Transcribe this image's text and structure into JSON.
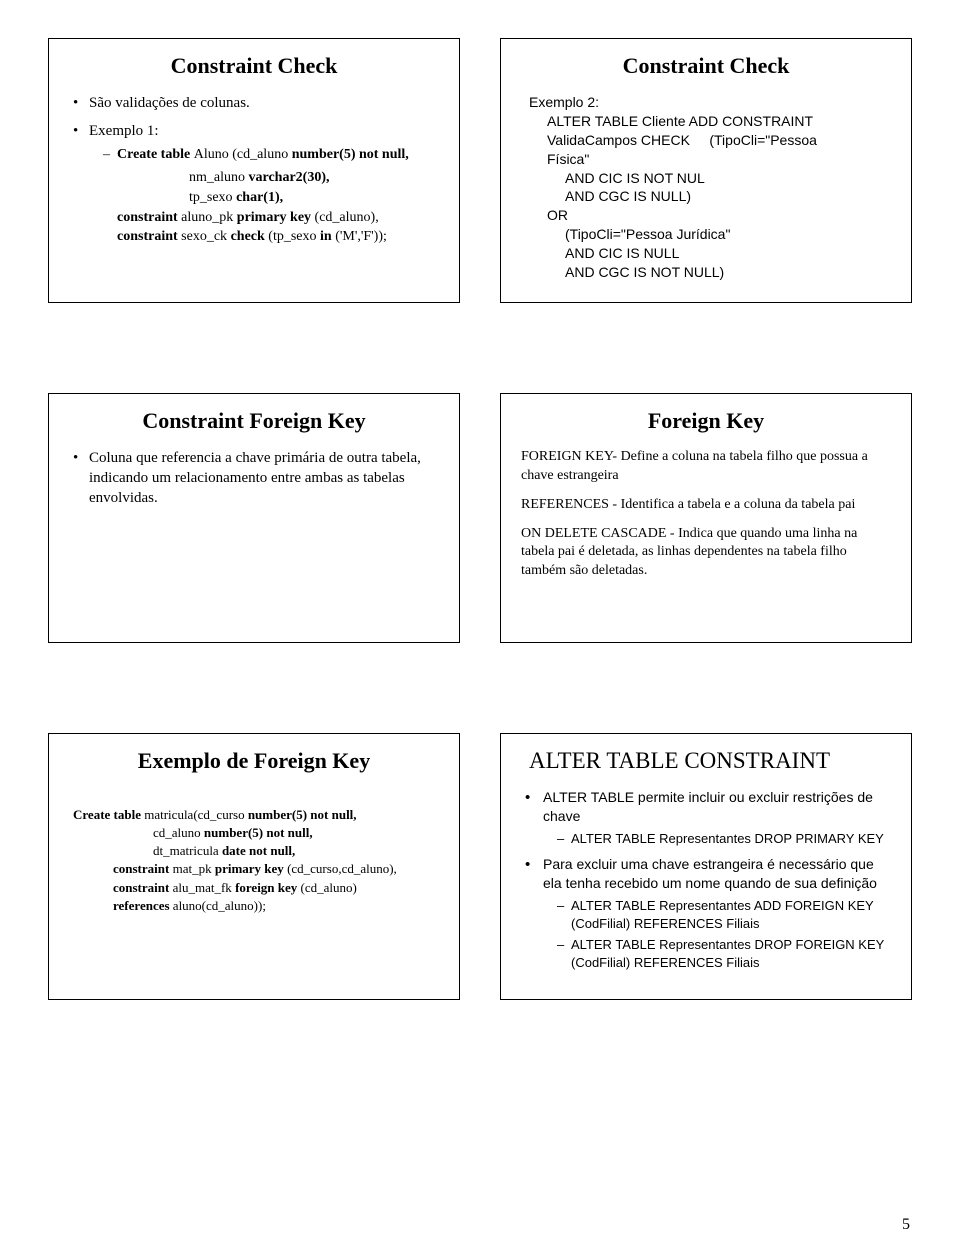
{
  "page_number": "5",
  "slides": {
    "s1": {
      "title": "Constraint Check",
      "bullet1": "São validações de colunas.",
      "bullet2": "Exemplo 1:",
      "code": {
        "l1a": "Create table ",
        "l1b": "Aluno (cd_aluno ",
        "l1c": "number(5) not null,",
        "l2a": "nm_aluno ",
        "l2b": "varchar2(30),",
        "l3a": "tp_sexo ",
        "l3b": "char(1),",
        "l4a": "constraint ",
        "l4b": "aluno_pk ",
        "l4c": "primary key ",
        "l4d": "(cd_aluno),",
        "l5a": "constraint ",
        "l5b": "sexo_ck ",
        "l5c": "check ",
        "l5d": "(tp_sexo ",
        "l5e": "in ",
        "l5f": "('M','F'));"
      }
    },
    "s2": {
      "title": "Constraint Check",
      "ex": "Exemplo 2:",
      "l1": "ALTER TABLE Cliente ADD CONSTRAINT",
      "l2a": "ValidaCampos CHECK",
      "l2b": "(TipoCli=\"Pessoa",
      "l3": "Física\"",
      "l4": "AND CIC IS NOT NUL",
      "l5": "AND CGC IS NULL)",
      "l6": "OR",
      "l7": "(TipoCli=\"Pessoa Jurídica\"",
      "l8": "AND CIC IS NULL",
      "l9": "AND CGC IS NOT NULL)"
    },
    "s3": {
      "title": "Constraint Foreign Key",
      "bullet": "Coluna que referencia a chave primária de outra tabela, indicando um relacionamento entre ambas as tabelas envolvidas."
    },
    "s4": {
      "title": "Foreign Key",
      "p1a": "FOREIGN KEY- ",
      "p1b": "Define a coluna na tabela filho que possua a chave estrangeira",
      "p2a": "REFERENCES - ",
      "p2b": "Identifica a tabela e a coluna da tabela pai",
      "p3a": "ON DELETE CASCADE - ",
      "p3b": "Indica que quando uma linha na tabela pai é deletada, as linhas dependentes na tabela filho também são deletadas."
    },
    "s5": {
      "title": "Exemplo de Foreign Key",
      "l1a": "Create table ",
      "l1b": "matricula(cd_curso ",
      "l1c": "number(5) not null,",
      "l2a": "cd_aluno ",
      "l2b": "number(5) not null,",
      "l3a": "dt_matricula ",
      "l3b": "date not null,",
      "l4a": "constraint ",
      "l4b": "mat_pk ",
      "l4c": "primary key ",
      "l4d": "(cd_curso,cd_aluno),",
      "l5a": "constraint ",
      "l5b": "alu_mat_fk ",
      "l5c": "foreign key ",
      "l5d": "(cd_aluno)",
      "l6a": "references ",
      "l6b": "aluno(cd_aluno));"
    },
    "s6": {
      "title": "ALTER TABLE CONSTRAINT",
      "b1": "ALTER TABLE permite incluir ou excluir restrições de chave",
      "b1s1": "ALTER TABLE Representantes DROP PRIMARY KEY",
      "b2": "Para excluir uma chave estrangeira é necessário que ela tenha recebido um nome quando de sua definição",
      "b2s1": "ALTER TABLE Representantes ADD FOREIGN KEY (CodFilial) REFERENCES Filiais",
      "b2s2": "ALTER TABLE Representantes DROP FOREIGN KEY (CodFilial) REFERENCES Filiais"
    }
  }
}
